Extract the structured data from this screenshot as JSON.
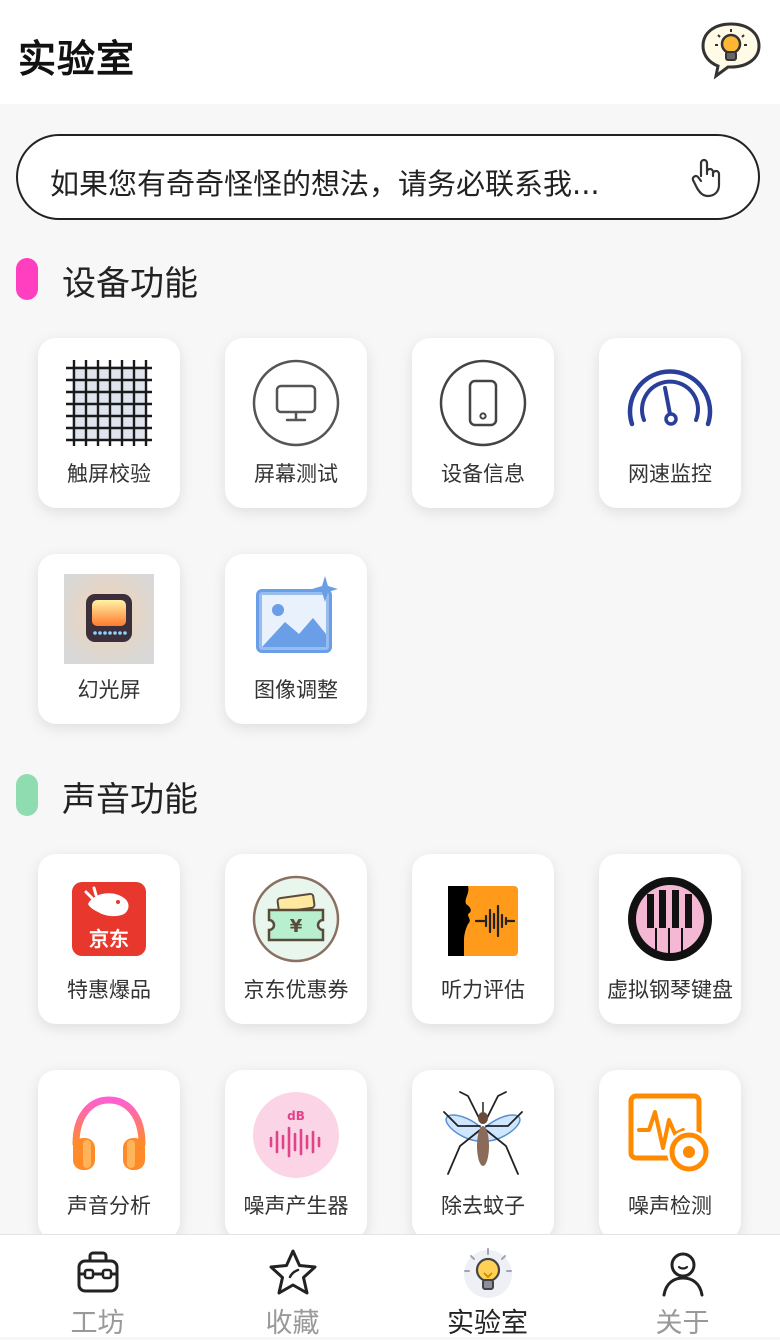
{
  "header": {
    "title": "实验室",
    "feedback_icon": "lightbulb-bubble-icon"
  },
  "search": {
    "text": "如果您有奇奇怪怪的想法，请务必联系我...",
    "icon": "pointer-hand-icon"
  },
  "sections": [
    {
      "title": "设备功能",
      "accent": "#ff3fbf",
      "items": [
        {
          "label": "触屏校验",
          "icon": "touch-grid-icon"
        },
        {
          "label": "屏幕测试",
          "icon": "monitor-icon"
        },
        {
          "label": "设备信息",
          "icon": "phone-icon"
        },
        {
          "label": "网速监控",
          "icon": "speedometer-icon"
        },
        {
          "label": "幻光屏",
          "icon": "glow-screen-icon"
        },
        {
          "label": "图像调整",
          "icon": "image-adjust-icon"
        }
      ]
    },
    {
      "title": "声音功能",
      "accent": "#8fdcb0",
      "items": [
        {
          "label": "特惠爆品",
          "icon": "jd-logo-icon",
          "logo_text": "京东"
        },
        {
          "label": "京东优惠券",
          "icon": "coupon-wallet-icon"
        },
        {
          "label": "听力评估",
          "icon": "hearing-test-icon"
        },
        {
          "label": "虚拟钢琴键盘",
          "icon": "piano-icon"
        },
        {
          "label": "声音分析",
          "icon": "headphones-icon"
        },
        {
          "label": "噪声产生器",
          "icon": "noise-generator-icon",
          "icon_text": "dB"
        },
        {
          "label": "除去蚊子",
          "icon": "mosquito-icon"
        },
        {
          "label": "噪声检测",
          "icon": "noise-monitor-icon"
        }
      ]
    }
  ],
  "nav": [
    {
      "label": "工坊",
      "icon": "toolbox-icon",
      "active": false
    },
    {
      "label": "收藏",
      "icon": "star-icon",
      "active": false
    },
    {
      "label": "实验室",
      "icon": "lightbulb-icon",
      "active": true
    },
    {
      "label": "关于",
      "icon": "user-icon",
      "active": false
    }
  ],
  "colors": {
    "accent_device": "#ff3fbf",
    "accent_sound": "#8fdcb0",
    "jd_red": "#e8372c",
    "speed_blue": "#2a3f9a",
    "image_blue": "#6a9ee6",
    "audio_orange": "#ff9a1a",
    "noise_orange": "#ff8a00"
  }
}
